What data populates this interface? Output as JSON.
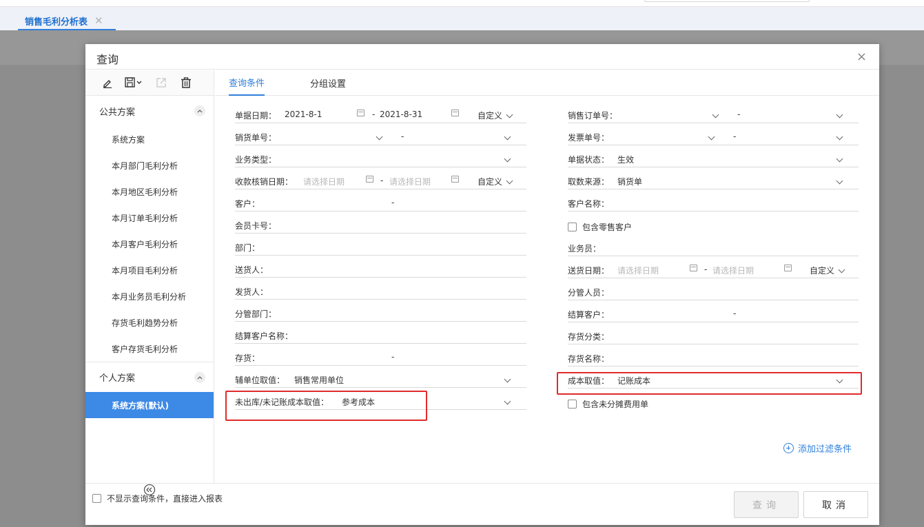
{
  "app": {
    "tab_label": "销售毛利分析表",
    "tab_close": "✕"
  },
  "dialog": {
    "title": "查询",
    "close": "×"
  },
  "sidebar": {
    "public_group": "公共方案",
    "public_items": [
      "系统方案",
      "本月部门毛利分析",
      "本月地区毛利分析",
      "本月订单毛利分析",
      "本月客户毛利分析",
      "本月项目毛利分析",
      "本月业务员毛利分析",
      "存货毛利趋势分析",
      "客户存货毛利分析"
    ],
    "personal_group": "个人方案",
    "personal_items": [
      "系统方案(默认)"
    ]
  },
  "tabs": [
    "查询条件",
    "分组设置"
  ],
  "left_fields": {
    "doc_date": {
      "label": "单据日期：",
      "from": "2021-8-1",
      "sep": "-",
      "to": "2021-8-31",
      "mode": "自定义"
    },
    "sales_no": {
      "label": "销货单号：",
      "sep": "-"
    },
    "biz_type": {
      "label": "业务类型："
    },
    "collect_date": {
      "label": "收款核销日期：",
      "from_ph": "请选择日期",
      "sep": "-",
      "to_ph": "请选择日期",
      "mode": "自定义"
    },
    "customer": {
      "label": "客户：",
      "sep": "-"
    },
    "member_card": {
      "label": "会员卡号："
    },
    "department": {
      "label": "部门："
    },
    "deliverer": {
      "label": "送货人："
    },
    "shipper": {
      "label": "发货人："
    },
    "mgr_dept": {
      "label": "分管部门："
    },
    "settle_cust_name": {
      "label": "结算客户名称："
    },
    "inventory": {
      "label": "存货：",
      "sep": "-"
    },
    "aux_unit": {
      "label": "辅单位取值：",
      "value": "销售常用单位"
    },
    "unstocked_cost": {
      "label": "未出库/未记账成本取值：",
      "value": "参考成本"
    }
  },
  "right_fields": {
    "sales_order_no": {
      "label": "销售订单号：",
      "sep": "-"
    },
    "invoice_no": {
      "label": "发票单号：",
      "sep": "-"
    },
    "doc_status": {
      "label": "单据状态：",
      "value": "生效"
    },
    "source": {
      "label": "取数来源：",
      "value": "销货单"
    },
    "cust_name": {
      "label": "客户名称："
    },
    "include_retail": {
      "label": "包含零售客户"
    },
    "salesman": {
      "label": "业务员："
    },
    "delivery_date": {
      "label": "送货日期：",
      "from_ph": "请选择日期",
      "sep": "-",
      "to_ph": "请选择日期",
      "mode": "自定义"
    },
    "mgr_person": {
      "label": "分管人员："
    },
    "settle_cust": {
      "label": "结算客户：",
      "sep": "-"
    },
    "inv_category": {
      "label": "存货分类："
    },
    "inv_name": {
      "label": "存货名称："
    },
    "cost_value": {
      "label": "成本取值：",
      "value": "记账成本"
    },
    "include_unalloc": {
      "label": "包含未分摊费用单"
    }
  },
  "add_filter": "添加过滤条件",
  "footer": {
    "skip_label": "不显示查询条件，直接进入报表",
    "query_btn": "查询",
    "cancel_btn": "取消"
  },
  "colors": {
    "accent": "#2f7fdb",
    "active_item": "#3d89e6",
    "highlight_border": "#e02a2a"
  }
}
